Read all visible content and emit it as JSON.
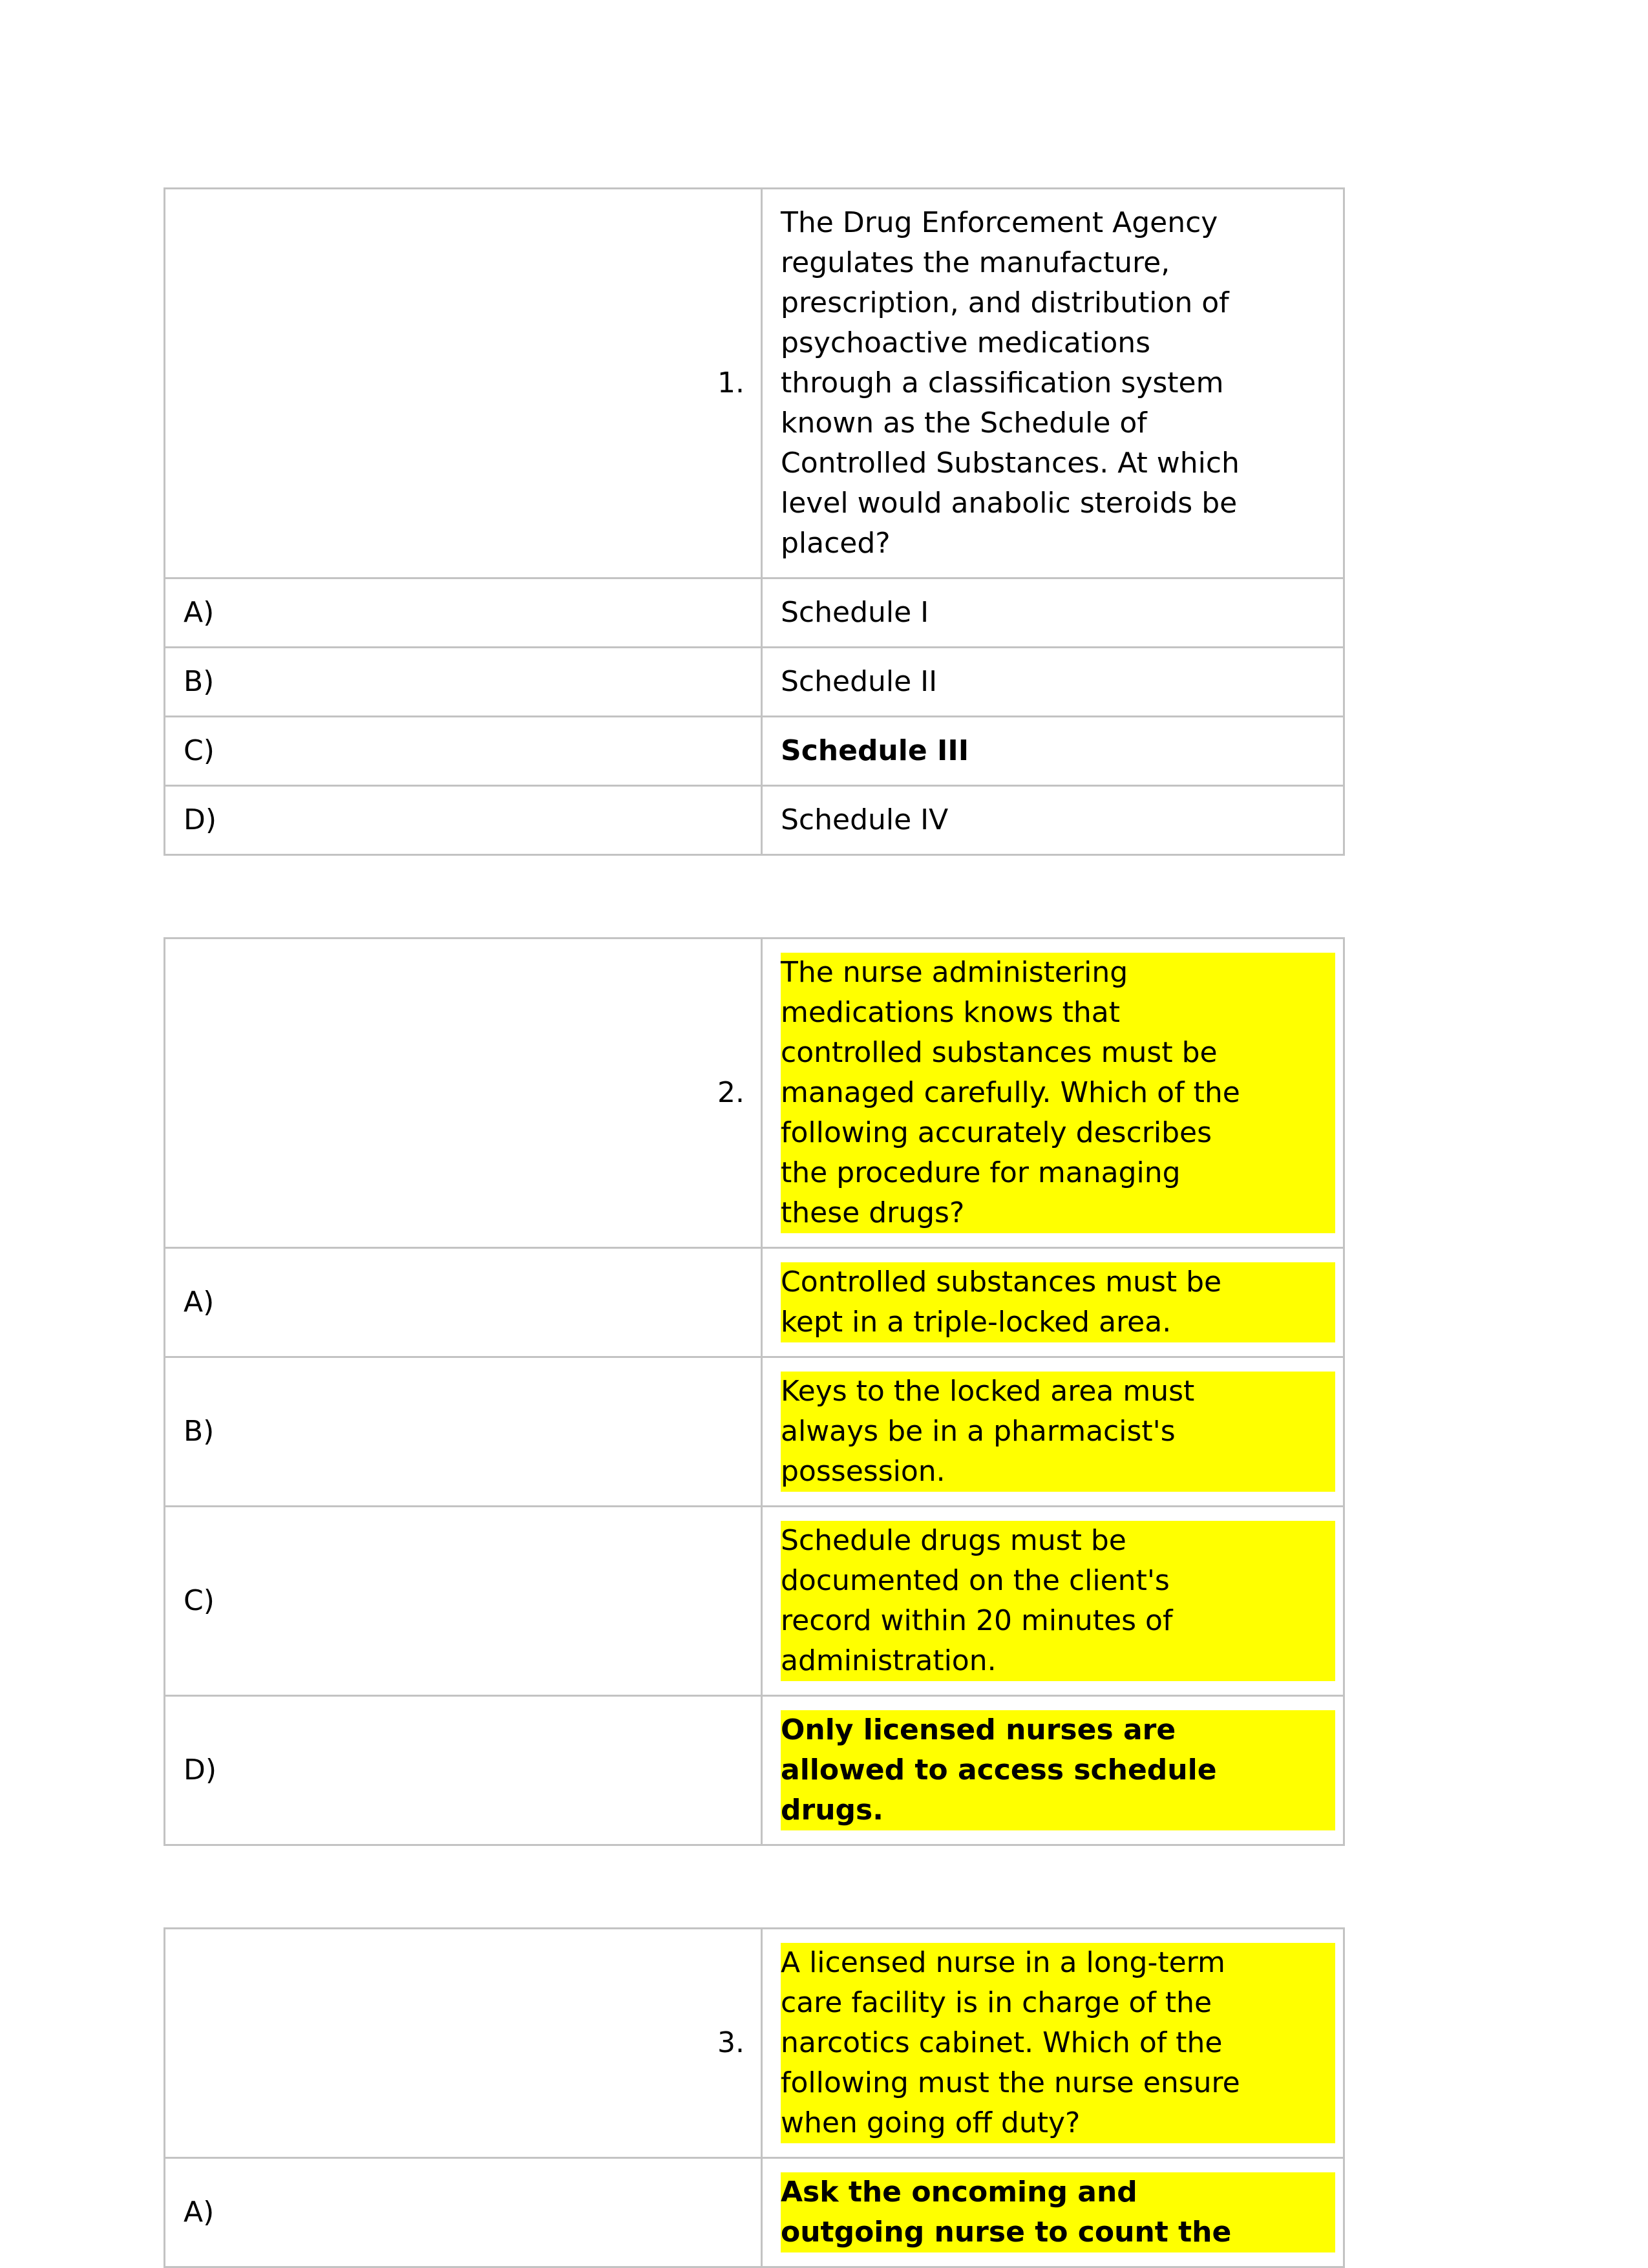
{
  "document": {
    "type": "multiple-choice-question-worksheet",
    "highlight_color": "#ffff00",
    "border_color": "#c3c3c3",
    "text_color": "#000000"
  },
  "questions": [
    {
      "number": "1.",
      "highlighted": false,
      "stem_lines": [
        "The Drug Enforcement Agency",
        "regulates the manufacture,",
        "prescription, and distribution of",
        "psychoactive medications",
        "through a classification system",
        "known as the Schedule of",
        "Controlled Substances. At which",
        "level would anabolic steroids be",
        "placed?"
      ],
      "options": [
        {
          "letter": "A)",
          "highlighted": false,
          "bold": false,
          "lines": [
            "Schedule I"
          ]
        },
        {
          "letter": "B)",
          "highlighted": false,
          "bold": false,
          "lines": [
            "Schedule II"
          ]
        },
        {
          "letter": "C)",
          "highlighted": false,
          "bold": true,
          "lines": [
            "Schedule III"
          ]
        },
        {
          "letter": "D)",
          "highlighted": false,
          "bold": false,
          "lines": [
            "Schedule IV"
          ]
        }
      ]
    },
    {
      "number": "2.",
      "highlighted": true,
      "stem_lines": [
        "The nurse administering",
        "medications knows that",
        "controlled substances must be",
        "managed carefully. Which of the",
        "following accurately describes",
        "the procedure for managing",
        "these drugs?"
      ],
      "options": [
        {
          "letter": "A)",
          "highlighted": true,
          "bold": false,
          "lines": [
            "Controlled substances must be",
            "kept in a triple-locked area."
          ]
        },
        {
          "letter": "B)",
          "highlighted": true,
          "bold": false,
          "lines": [
            "Keys to the locked area must",
            "always be in a pharmacist's",
            "possession."
          ]
        },
        {
          "letter": "C)",
          "highlighted": true,
          "bold": false,
          "lines": [
            "Schedule drugs must be",
            "documented on the client's",
            "record within 20 minutes of",
            "administration."
          ]
        },
        {
          "letter": "D)",
          "highlighted": true,
          "bold": true,
          "lines": [
            "Only licensed nurses are",
            "allowed to access schedule",
            "drugs."
          ]
        }
      ]
    },
    {
      "number": "3.",
      "highlighted": true,
      "stem_lines": [
        "A licensed nurse in a long-term",
        "care facility is in charge of the",
        "narcotics cabinet. Which of the",
        "following must the nurse ensure",
        "when going off duty?"
      ],
      "options": [
        {
          "letter": "A)",
          "highlighted": true,
          "bold": true,
          "lines": [
            "Ask the oncoming and",
            "outgoing nurse to count the"
          ]
        }
      ]
    }
  ]
}
